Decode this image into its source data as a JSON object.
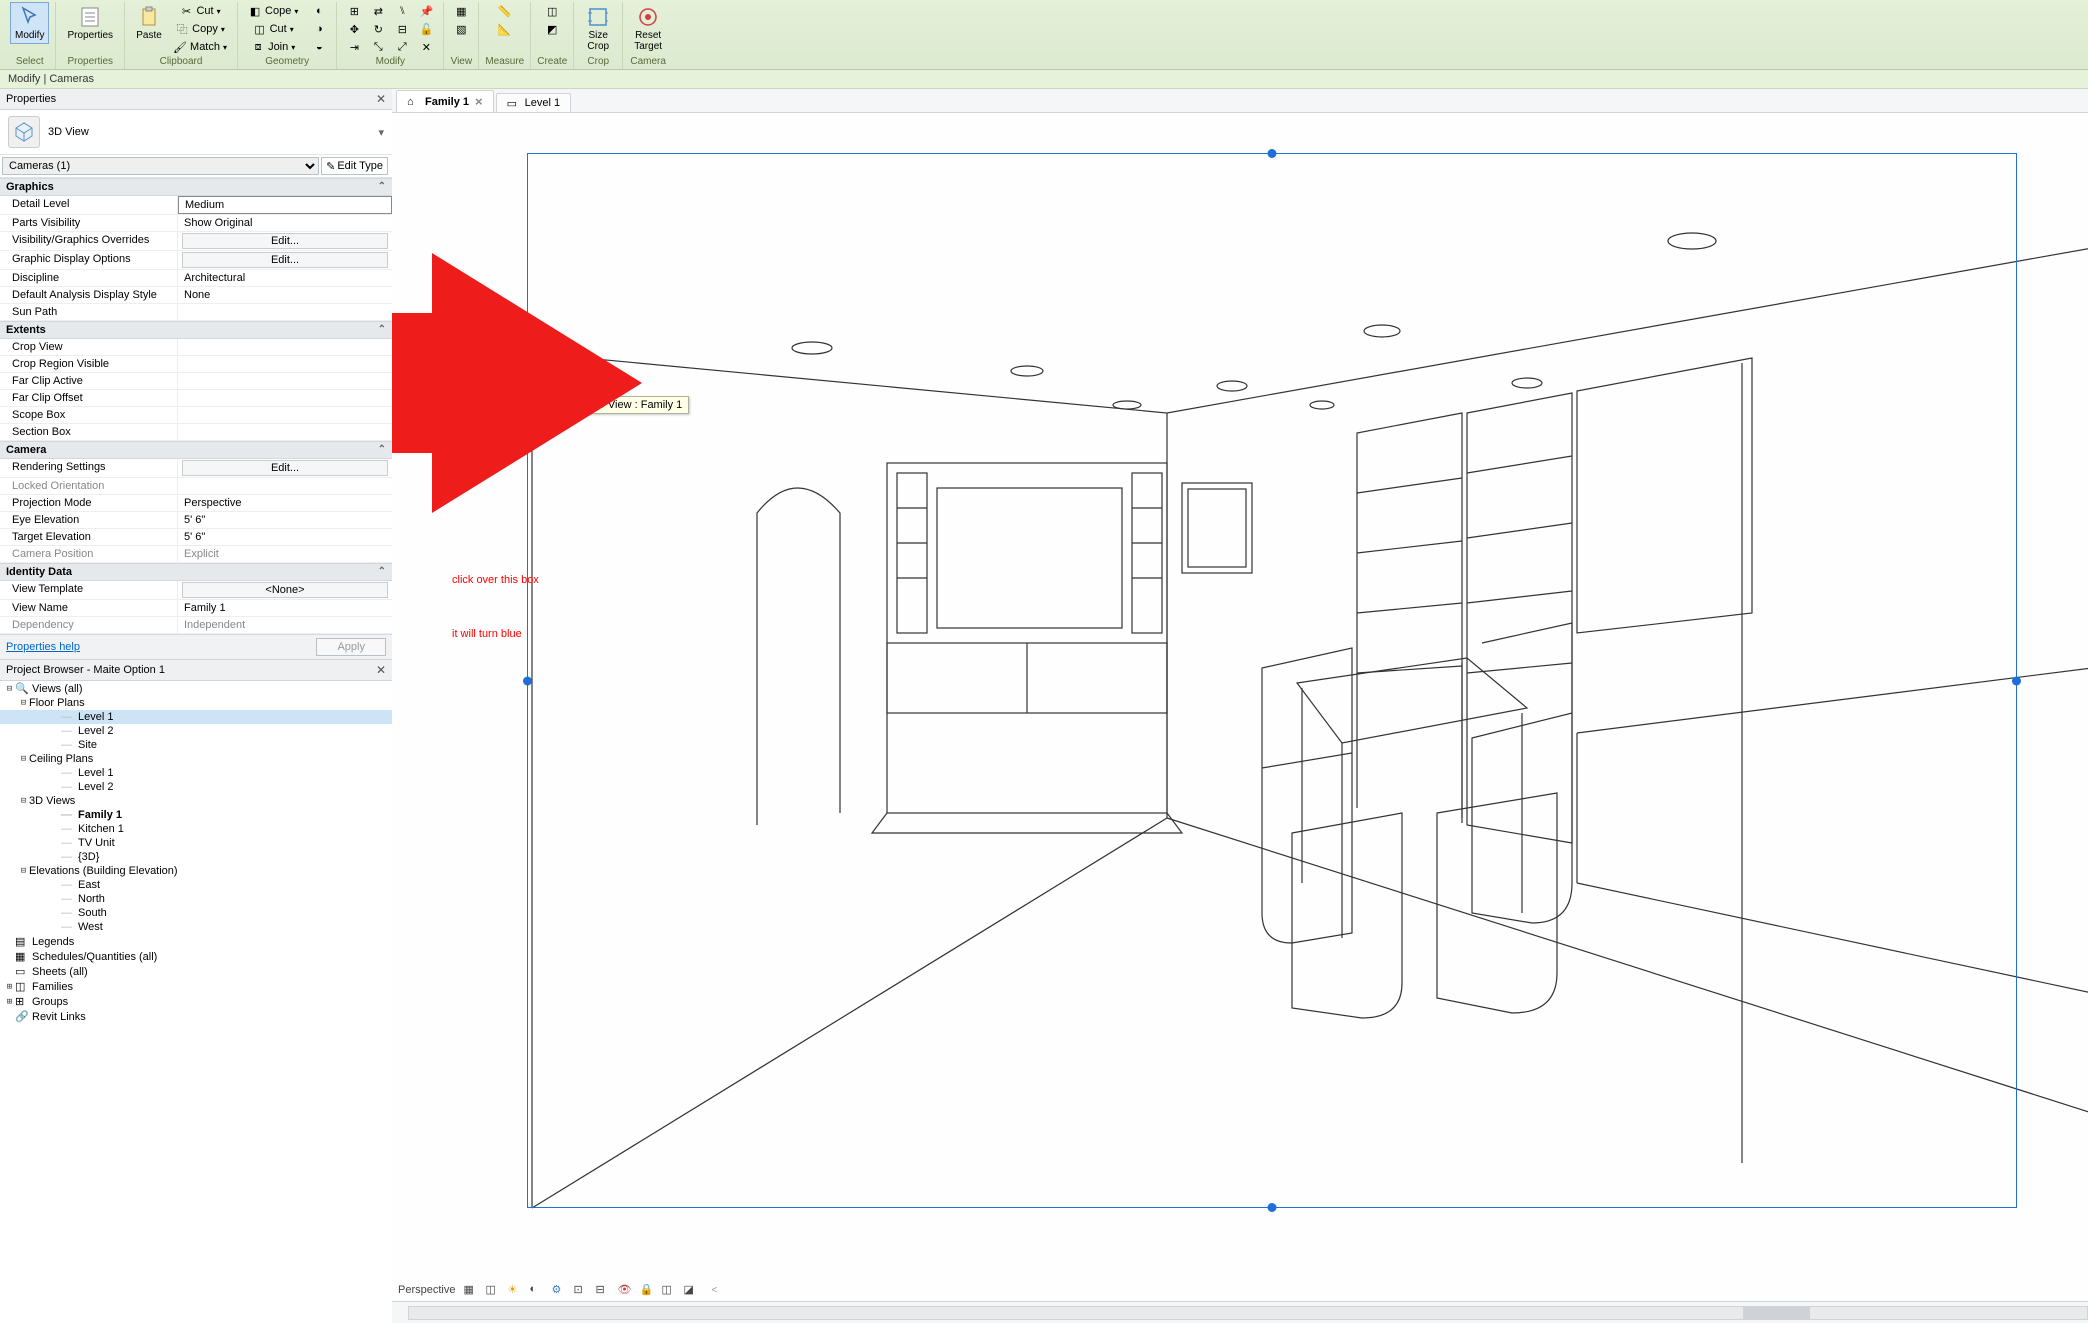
{
  "ribbon": {
    "groups": [
      {
        "title": "Select",
        "items": [
          {
            "label": "Modify",
            "icon": "cursor",
            "sel": true
          }
        ]
      },
      {
        "title": "Properties",
        "items": [
          {
            "label": "Properties",
            "icon": "props"
          }
        ]
      },
      {
        "title": "Clipboard",
        "items": [
          {
            "label": "Paste",
            "icon": "paste"
          }
        ],
        "small": [
          {
            "label": "Cut",
            "icon": "scissors"
          },
          {
            "label": "Copy",
            "icon": "copy"
          },
          {
            "label": "Match",
            "icon": "brush"
          }
        ]
      },
      {
        "title": "Geometry",
        "small": [
          {
            "label": "Cope",
            "icon": "cope"
          },
          {
            "label": "Cut",
            "icon": "cut"
          },
          {
            "label": "Join",
            "icon": "join"
          }
        ],
        "extra": [
          "g1",
          "g2",
          "g3",
          "g4",
          "g5",
          "g6"
        ]
      },
      {
        "title": "Modify",
        "extra": [
          "m1",
          "m2",
          "m3",
          "m4",
          "m5",
          "m6",
          "m7",
          "m8",
          "m9",
          "m10",
          "m11",
          "m12"
        ]
      },
      {
        "title": "View",
        "extra": [
          "v1",
          "v2"
        ]
      },
      {
        "title": "Measure",
        "extra": [
          "me1",
          "me2"
        ]
      },
      {
        "title": "Create",
        "extra": [
          "c1",
          "c2"
        ]
      },
      {
        "title": "Crop",
        "items": [
          {
            "label": "Size\nCrop",
            "icon": "sizecrop"
          }
        ]
      },
      {
        "title": "Camera",
        "items": [
          {
            "label": "Reset\nTarget",
            "icon": "reset"
          }
        ]
      }
    ]
  },
  "modify_bar": "Modify | Cameras",
  "properties": {
    "title": "Properties",
    "type_label": "3D View",
    "filter": "Cameras (1)",
    "edit_type": "Edit Type",
    "sections": [
      {
        "name": "Graphics",
        "rows": [
          {
            "k": "Detail Level",
            "v": "Medium",
            "boxed": true
          },
          {
            "k": "Parts Visibility",
            "v": "Show Original"
          },
          {
            "k": "Visibility/Graphics Overrides",
            "v": "Edit...",
            "btn": true
          },
          {
            "k": "Graphic Display Options",
            "v": "Edit...",
            "btn": true
          },
          {
            "k": "Discipline",
            "v": "Architectural"
          },
          {
            "k": "Default Analysis Display Style",
            "v": "None"
          },
          {
            "k": "Sun Path",
            "v": ""
          }
        ]
      },
      {
        "name": "Extents",
        "rows": [
          {
            "k": "Crop View",
            "v": ""
          },
          {
            "k": "Crop Region Visible",
            "v": ""
          },
          {
            "k": "Far Clip Active",
            "v": ""
          },
          {
            "k": "Far Clip Offset",
            "v": ""
          },
          {
            "k": "Scope Box",
            "v": ""
          },
          {
            "k": "Section Box",
            "v": ""
          }
        ]
      },
      {
        "name": "Camera",
        "rows": [
          {
            "k": "Rendering Settings",
            "v": "Edit...",
            "btn": true
          },
          {
            "k": "Locked Orientation",
            "v": "",
            "dis": true
          },
          {
            "k": "Projection Mode",
            "v": "Perspective"
          },
          {
            "k": "Eye Elevation",
            "v": "5'  6\""
          },
          {
            "k": "Target Elevation",
            "v": "5'  6\""
          },
          {
            "k": "Camera Position",
            "v": "Explicit",
            "dis": true
          }
        ]
      },
      {
        "name": "Identity Data",
        "rows": [
          {
            "k": "View Template",
            "v": "<None>",
            "btn": true
          },
          {
            "k": "View Name",
            "v": "Family 1"
          },
          {
            "k": "Dependency",
            "v": "Independent",
            "dis": true
          }
        ]
      }
    ],
    "help": "Properties help",
    "apply": "Apply"
  },
  "browser": {
    "title": "Project Browser - Maite Option 1",
    "tree": [
      {
        "t": "Views (all)",
        "tw": "-",
        "l": 0,
        "ic": "views"
      },
      {
        "t": "Floor Plans",
        "tw": "-",
        "l": 1
      },
      {
        "t": "Level 1",
        "l": 3,
        "sel": true,
        "leaf": true
      },
      {
        "t": "Level 2",
        "l": 3,
        "leaf": true
      },
      {
        "t": "Site",
        "l": 3,
        "leaf": true
      },
      {
        "t": "Ceiling Plans",
        "tw": "-",
        "l": 1
      },
      {
        "t": "Level 1",
        "l": 3,
        "leaf": true
      },
      {
        "t": "Level 2",
        "l": 3,
        "leaf": true
      },
      {
        "t": "3D Views",
        "tw": "-",
        "l": 1
      },
      {
        "t": "Family 1",
        "l": 3,
        "bold": true,
        "leaf": true
      },
      {
        "t": "Kitchen 1",
        "l": 3,
        "leaf": true
      },
      {
        "t": "TV Unit",
        "l": 3,
        "leaf": true
      },
      {
        "t": "{3D}",
        "l": 3,
        "leaf": true
      },
      {
        "t": "Elevations (Building Elevation)",
        "tw": "-",
        "l": 1
      },
      {
        "t": "East",
        "l": 3,
        "leaf": true
      },
      {
        "t": "North",
        "l": 3,
        "leaf": true
      },
      {
        "t": "South",
        "l": 3,
        "leaf": true
      },
      {
        "t": "West",
        "l": 3,
        "leaf": true
      },
      {
        "t": "Legends",
        "l": 0,
        "ic": "legend"
      },
      {
        "t": "Schedules/Quantities (all)",
        "l": 0,
        "ic": "sched"
      },
      {
        "t": "Sheets (all)",
        "l": 0,
        "ic": "sheet"
      },
      {
        "t": "Families",
        "tw": "+",
        "l": 0,
        "ic": "fam"
      },
      {
        "t": "Groups",
        "tw": "+",
        "l": 0,
        "ic": "grp"
      },
      {
        "t": "Revit Links",
        "l": 0,
        "ic": "link"
      }
    ]
  },
  "tabs": [
    {
      "label": "Family 1",
      "ic": "home",
      "active": true,
      "x": true
    },
    {
      "label": "Level 1",
      "ic": "plan",
      "active": false,
      "x": false
    }
  ],
  "tooltip": "Cameras : 3D View : Family 1",
  "annotation": {
    "l1": "click over this box",
    "l2": "it will turn blue"
  },
  "viewcontrol": {
    "scale": "Perspective"
  }
}
